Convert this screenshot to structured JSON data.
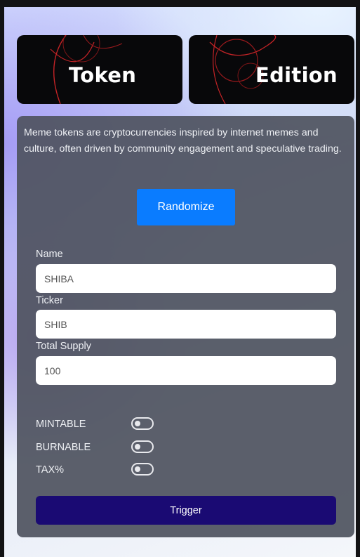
{
  "banners": {
    "left_title": "Token",
    "right_title": "Edition"
  },
  "panel": {
    "description": "Meme tokens are cryptocurrencies inspired by internet memes and culture, often driven by community engagement and speculative trading.",
    "randomize_label": "Randomize"
  },
  "form": {
    "name_label": "Name",
    "name_value": "SHIBA",
    "ticker_label": "Ticker",
    "ticker_value": "SHIB",
    "supply_label": "Total Supply",
    "supply_value": "100"
  },
  "toggles": [
    {
      "label": "MINTABLE",
      "on": false
    },
    {
      "label": "BURNABLE",
      "on": false
    },
    {
      "label": "TAX%",
      "on": false
    }
  ],
  "trigger_label": "Trigger",
  "colors": {
    "accent": "#0a7cff",
    "trigger": "#1a0a73",
    "panel": "#4e525e",
    "banner": "#08080a",
    "banner_arc": "#d8282a"
  }
}
